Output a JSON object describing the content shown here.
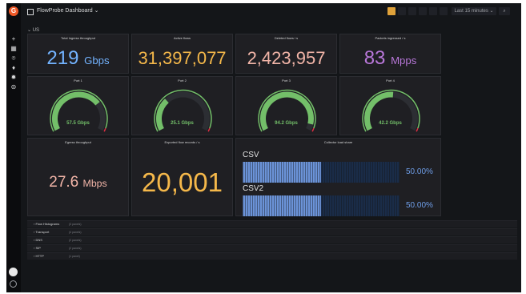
{
  "header": {
    "title": "FlowProbe Dashboard ⌄",
    "toolbar": [
      "add",
      "star",
      "share",
      "save",
      "settings",
      "tv"
    ],
    "time_range": "Last 15 minutes ⌄",
    "zoom_out": "⌕"
  },
  "sidebar": [
    "+",
    "▦",
    "⌾",
    "♦",
    "✹",
    "⊜"
  ],
  "row_title": "⌄ US",
  "stats": [
    {
      "title": "Total Ingress throughput",
      "value": "219",
      "unit": "Gbps",
      "color": "#73b3ff"
    },
    {
      "title": "Active flows",
      "value": "31,397,077",
      "unit": "",
      "color": "#f5b84a"
    },
    {
      "title": "Deleted flows / s",
      "value": "2,423,957",
      "unit": "",
      "color": "#f2b5a8"
    },
    {
      "title": "Packets ingressed / s",
      "value": "83",
      "unit": "Mpps",
      "color": "#b877d9"
    }
  ],
  "gauges": [
    {
      "title": "Port 1",
      "label": "57.5 Gbps",
      "fraction": 0.72
    },
    {
      "title": "Port 2",
      "label": "25.1 Gbps",
      "fraction": 0.32
    },
    {
      "title": "Port 3",
      "label": "94.2 Gbps",
      "fraction": 0.94
    },
    {
      "title": "Port 4",
      "label": "42.2 Gbps",
      "fraction": 0.52
    }
  ],
  "egress": {
    "title": "Egress throughput",
    "value": "27.6",
    "unit": "Mbps",
    "color": "#f2b5a8"
  },
  "exported": {
    "title": "Exported flow records / s",
    "value": "20,001",
    "color": "#f5b84a"
  },
  "collector": {
    "title": "Collector load share",
    "bars": [
      {
        "name": "CSV",
        "value": "50.00%",
        "fraction": 0.5
      },
      {
        "name": "CSV2",
        "value": "50.00%",
        "fraction": 0.5
      }
    ]
  },
  "collapsed_rows": [
    {
      "title": "Flow Histograms",
      "count": "(3 panels)"
    },
    {
      "title": "Transport",
      "count": "(4 panels)"
    },
    {
      "title": "DNS",
      "count": "(2 panels)"
    },
    {
      "title": "SIP",
      "count": "(2 panels)"
    },
    {
      "title": "HTTP",
      "count": "(1 panel)"
    }
  ]
}
